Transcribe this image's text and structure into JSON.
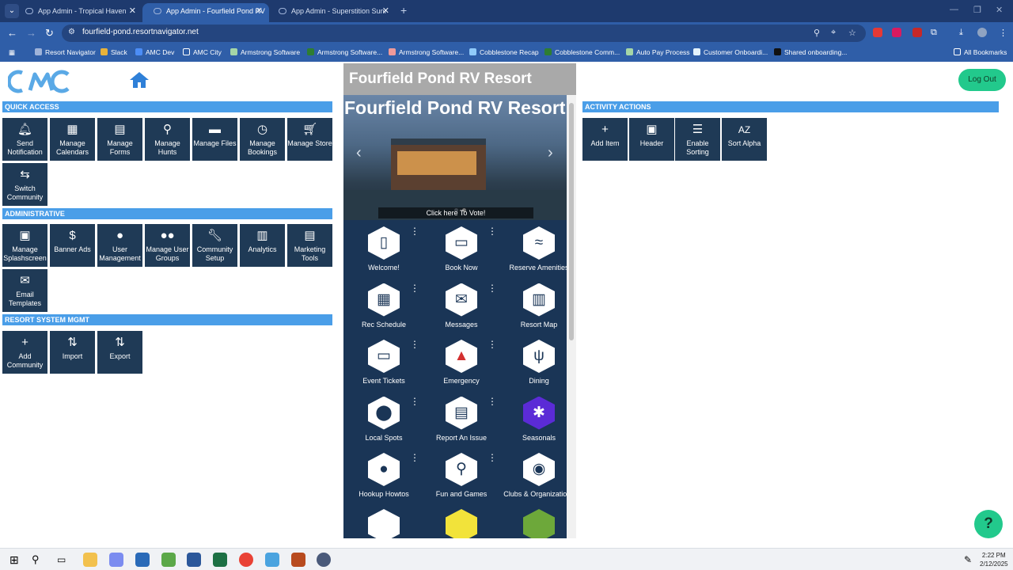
{
  "browser": {
    "tabs": [
      {
        "title": "App Admin - Tropical Haven"
      },
      {
        "title": "App Admin - Fourfield Pond RV"
      },
      {
        "title": "App Admin - Superstition Sunr"
      }
    ],
    "url": "fourfield-pond.resortnavigator.net",
    "bookmarks": [
      "Resort Navigator",
      "Slack",
      "AMC Dev",
      "AMC City",
      "Armstrong Software",
      "Armstrong Software...",
      "Armstrong Software...",
      "Cobblestone Recap",
      "Cobblestone Comm...",
      "Auto Pay Process",
      "Customer Onboardi...",
      "Shared onboarding..."
    ],
    "all_bookmarks": "All Bookmarks"
  },
  "app": {
    "logout_label": "Log Out",
    "quick_access": {
      "title": "QUICK ACCESS",
      "items": [
        {
          "label": "Send Notification",
          "icon": "bell-icon"
        },
        {
          "label": "Manage Calendars",
          "icon": "calendar-icon"
        },
        {
          "label": "Manage Forms",
          "icon": "clipboard-icon"
        },
        {
          "label": "Manage Hunts",
          "icon": "search-icon"
        },
        {
          "label": "Manage Files",
          "icon": "folder-icon"
        },
        {
          "label": "Manage Bookings",
          "icon": "clock-icon"
        },
        {
          "label": "Manage Store",
          "icon": "cart-icon"
        },
        {
          "label": "Switch Community",
          "icon": "map-icon"
        }
      ]
    },
    "administrative": {
      "title": "ADMINISTRATIVE",
      "items": [
        {
          "label": "Manage Splashscreen",
          "icon": "image-icon"
        },
        {
          "label": "Banner Ads",
          "icon": "dollar-icon"
        },
        {
          "label": "User Management",
          "icon": "person-icon"
        },
        {
          "label": "Manage User Groups",
          "icon": "people-icon"
        },
        {
          "label": "Community Setup",
          "icon": "wrench-icon"
        },
        {
          "label": "Analytics",
          "icon": "chart-icon"
        },
        {
          "label": "Marketing Tools",
          "icon": "grid-icon"
        },
        {
          "label": "Email Templates",
          "icon": "mail-icon"
        }
      ]
    },
    "resort_system": {
      "title": "RESORT SYSTEM MGMT",
      "items": [
        {
          "label": "Add Community",
          "icon": "plus-icon"
        },
        {
          "label": "Import",
          "icon": "sort-icon"
        },
        {
          "label": "Export",
          "icon": "sort-icon"
        }
      ]
    },
    "activity_actions": {
      "title": "ACTIVITY ACTIONS",
      "items": [
        {
          "label": "Add Item",
          "icon": "plus-icon"
        },
        {
          "label": "Header",
          "icon": "image-icon"
        },
        {
          "label": "Enable Sorting",
          "icon": "lines-icon"
        },
        {
          "label": "Sort Alpha",
          "icon": "az-icon"
        }
      ]
    },
    "preview": {
      "header": "Fourfield Pond RV Resort",
      "banner_title": "Fourfield Pond RV Resort",
      "vote": "Click here To Vote!",
      "items": [
        {
          "label": "Welcome!",
          "icon": "phone-icon"
        },
        {
          "label": "Book Now",
          "icon": "rv-icon"
        },
        {
          "label": "Reserve Amenities",
          "icon": "swim-icon"
        },
        {
          "label": "Rec Schedule",
          "icon": "calendar-icon"
        },
        {
          "label": "Messages",
          "icon": "mail-icon"
        },
        {
          "label": "Resort Map",
          "icon": "map-icon"
        },
        {
          "label": "Event Tickets",
          "icon": "ticket-icon"
        },
        {
          "label": "Emergency",
          "icon": "siren-icon"
        },
        {
          "label": "Dining",
          "icon": "fork-knife-icon"
        },
        {
          "label": "Local Spots",
          "icon": "pin-icon"
        },
        {
          "label": "Report An Issue",
          "icon": "clipboard-icon"
        },
        {
          "label": "Seasonals",
          "icon": "leaf-icon"
        },
        {
          "label": "Hookup Howtos",
          "icon": "drop-icon"
        },
        {
          "label": "Fun and Games",
          "icon": "search-icon"
        },
        {
          "label": "Clubs & Organizations",
          "icon": "ball-icon"
        }
      ]
    }
  },
  "taskbar": {
    "time": "2:22 PM",
    "date": "2/12/2025"
  }
}
